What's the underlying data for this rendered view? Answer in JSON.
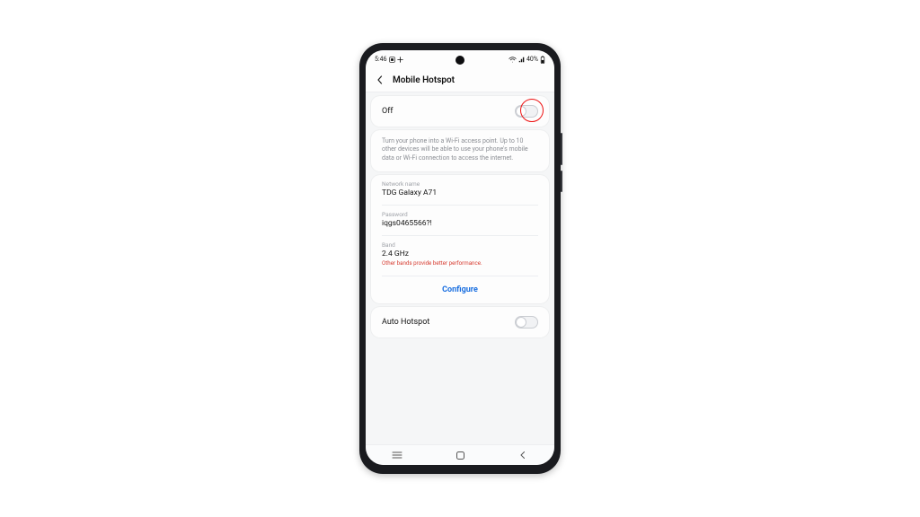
{
  "status": {
    "time": "5:46",
    "battery": "40%"
  },
  "header": {
    "title": "Mobile Hotspot"
  },
  "main": {
    "state_label": "Off",
    "description": "Turn your phone into a Wi-Fi access point. Up to 10 other devices will be able to use your phone's mobile data or Wi-Fi connection to access the internet.",
    "network_name_label": "Network name",
    "network_name_value": "TDG Galaxy A71",
    "password_label": "Password",
    "password_value": "iqgs0465566?!",
    "band_label": "Band",
    "band_value": "2.4 GHz",
    "band_note": "Other bands provide better performance.",
    "configure_label": "Configure"
  },
  "auto": {
    "label": "Auto Hotspot"
  }
}
